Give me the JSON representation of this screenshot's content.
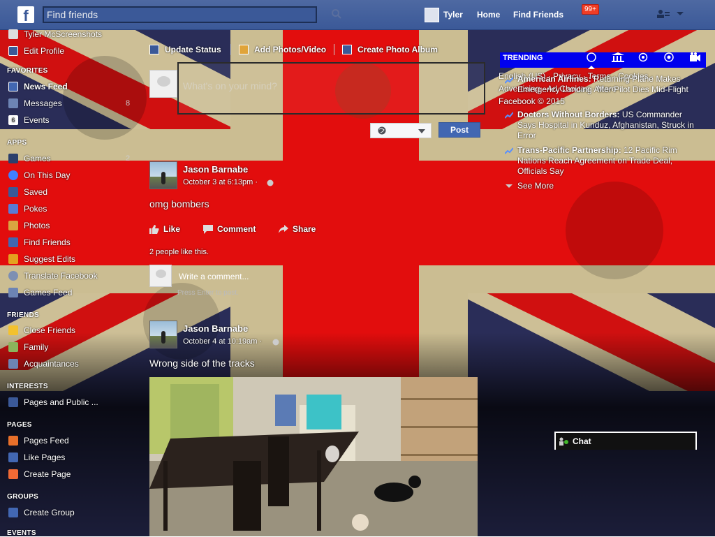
{
  "topbar": {
    "logo": "f",
    "search_placeholder": "Find friends",
    "user_name": "Tyler",
    "home": "Home",
    "find_friends": "Find Friends",
    "notification_badge": "99+"
  },
  "nav": {
    "profile_name": "Tyler McScreenshots",
    "edit_profile": "Edit Profile",
    "favorites_heading": "FAVORITES",
    "news_feed": "News Feed",
    "messages": "Messages",
    "messages_count": "8",
    "events": "Events",
    "apps_heading": "APPS",
    "games": "Games",
    "games_count": "2",
    "on_this_day": "On This Day",
    "saved": "Saved",
    "pokes": "Pokes",
    "photos": "Photos",
    "find_friends": "Find Friends",
    "suggest_edits": "Suggest Edits",
    "translate": "Translate Facebook",
    "games_feed": "Games Feed",
    "friends_heading": "FRIENDS",
    "close_friends": "Close Friends",
    "family": "Family",
    "acquaintances": "Acquaintances",
    "interests_heading": "INTERESTS",
    "pages_public": "Pages and Public ...",
    "pages_heading": "PAGES",
    "pages_feed": "Pages Feed",
    "like_pages": "Like Pages",
    "create_page": "Create Page",
    "groups_heading": "GROUPS",
    "create_group": "Create Group",
    "events_heading": "EVENTS"
  },
  "composer": {
    "update_status": "Update Status",
    "add_photos": "Add Photos/Video",
    "create_album": "Create Photo Album",
    "placeholder": "What's on your mind?",
    "privacy": "Public",
    "post": "Post"
  },
  "stories": [
    {
      "author": "Jason Barnabe",
      "time": "October 3 at 6:13pm · ",
      "text": "omg bombers",
      "like": "Like",
      "comment": "Comment",
      "share": "Share",
      "likes_summary": "2 people like this.",
      "comment_placeholder": "Write a comment...",
      "comment_hint": "Press Enter to post."
    },
    {
      "author": "Jason Barnabe",
      "time": "October 4 at 10:19am · ",
      "text": "Wrong side of the tracks"
    }
  ],
  "trending": {
    "title": "TRENDING",
    "footer_line1": "English (US) · Privacy · Terms · Cookies ·",
    "footer_line2": "Advertising · Ad Choices · More ·",
    "footer_line3": "Facebook © 2015",
    "items": [
      {
        "bold": "American Airlines:",
        "text": " Returning Plane Makes Emergency Landing After Pilot Dies Mid-Flight"
      },
      {
        "bold": "Doctors Without Borders:",
        "text": " US Commander Says Hospital in Kunduz, Afghanistan, Struck in Error"
      },
      {
        "bold": "Trans-Pacific Partnership:",
        "text": " 12 Pacific Rim Nations Reach Agreement on Trade Deal, Officials Say"
      }
    ],
    "see_more": "See More"
  },
  "chat": {
    "label": "Chat"
  },
  "colors": {
    "brand": "#3b5998",
    "trend_bar": "#0000ee",
    "badge": "#f03d25"
  }
}
